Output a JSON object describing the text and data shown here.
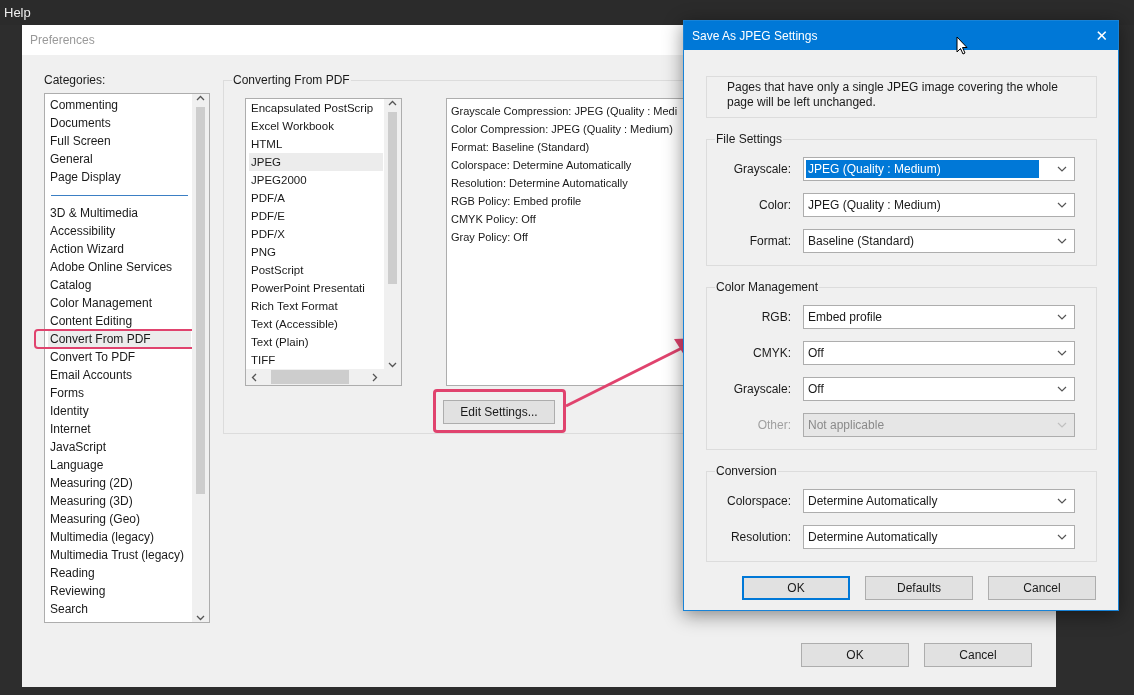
{
  "menu_bar": {
    "items": [
      "Help"
    ]
  },
  "preferences": {
    "title": "Preferences",
    "categories_label": "Categories:",
    "category_groups": [
      {
        "items": [
          {
            "label": "Commenting",
            "selected": false
          },
          {
            "label": "Documents",
            "selected": false
          },
          {
            "label": "Full Screen",
            "selected": false
          },
          {
            "label": "General",
            "selected": false
          },
          {
            "label": "Page Display",
            "selected": false
          }
        ]
      },
      {
        "items": [
          {
            "label": "3D & Multimedia",
            "selected": false
          },
          {
            "label": "Accessibility",
            "selected": false
          },
          {
            "label": "Action Wizard",
            "selected": false
          },
          {
            "label": "Adobe Online Services",
            "selected": false
          },
          {
            "label": "Catalog",
            "selected": false
          },
          {
            "label": "Color Management",
            "selected": false
          },
          {
            "label": "Content Editing",
            "selected": false
          },
          {
            "label": "Convert From PDF",
            "selected": true
          },
          {
            "label": "Convert To PDF",
            "selected": false
          },
          {
            "label": "Email Accounts",
            "selected": false
          },
          {
            "label": "Forms",
            "selected": false
          },
          {
            "label": "Identity",
            "selected": false
          },
          {
            "label": "Internet",
            "selected": false
          },
          {
            "label": "JavaScript",
            "selected": false
          },
          {
            "label": "Language",
            "selected": false
          },
          {
            "label": "Measuring (2D)",
            "selected": false
          },
          {
            "label": "Measuring (3D)",
            "selected": false
          },
          {
            "label": "Measuring (Geo)",
            "selected": false
          },
          {
            "label": "Multimedia (legacy)",
            "selected": false
          },
          {
            "label": "Multimedia Trust (legacy)",
            "selected": false
          },
          {
            "label": "Reading",
            "selected": false
          },
          {
            "label": "Reviewing",
            "selected": false
          },
          {
            "label": "Search",
            "selected": false
          }
        ]
      }
    ],
    "group_title": "Converting From PDF",
    "formats": [
      {
        "label": "Encapsulated PostScrip",
        "selected": false
      },
      {
        "label": "Excel Workbook",
        "selected": false
      },
      {
        "label": "HTML",
        "selected": false
      },
      {
        "label": "JPEG",
        "selected": true
      },
      {
        "label": "JPEG2000",
        "selected": false
      },
      {
        "label": "PDF/A",
        "selected": false
      },
      {
        "label": "PDF/E",
        "selected": false
      },
      {
        "label": "PDF/X",
        "selected": false
      },
      {
        "label": "PNG",
        "selected": false
      },
      {
        "label": "PostScript",
        "selected": false
      },
      {
        "label": "PowerPoint Presentati",
        "selected": false
      },
      {
        "label": "Rich Text Format",
        "selected": false
      },
      {
        "label": "Text (Accessible)",
        "selected": false
      },
      {
        "label": "Text (Plain)",
        "selected": false
      },
      {
        "label": "TIFF",
        "selected": false
      }
    ],
    "description": [
      "Grayscale Compression: JPEG (Quality : Medi",
      "Color Compression: JPEG (Quality : Medium)",
      "Format: Baseline (Standard)",
      "Colorspace: Determine Automatically",
      "Resolution: Determine Automatically",
      "RGB Policy: Embed profile",
      "CMYK Policy: Off",
      "Gray Policy: Off"
    ],
    "edit_button": "Edit Settings...",
    "buttons": [
      {
        "label": "OK"
      },
      {
        "label": "Cancel"
      }
    ]
  },
  "dialog": {
    "title": "Save As JPEG Settings",
    "close": "✕",
    "note": "Pages that have only a single JPEG image covering the whole page will be left unchanged.",
    "groups": [
      {
        "title": "File Settings",
        "fields": [
          {
            "label": "Grayscale:",
            "value": "JPEG (Quality : Medium)",
            "text_selected": true,
            "disabled": false
          },
          {
            "label": "Color:",
            "value": "JPEG (Quality : Medium)",
            "text_selected": false,
            "disabled": false
          },
          {
            "label": "Format:",
            "value": "Baseline (Standard)",
            "text_selected": false,
            "disabled": false
          }
        ]
      },
      {
        "title": "Color Management",
        "fields": [
          {
            "label": "RGB:",
            "value": "Embed profile",
            "text_selected": false,
            "disabled": false
          },
          {
            "label": "CMYK:",
            "value": "Off",
            "text_selected": false,
            "disabled": false
          },
          {
            "label": "Grayscale:",
            "value": "Off",
            "text_selected": false,
            "disabled": false
          },
          {
            "label": "Other:",
            "value": "Not applicable",
            "text_selected": false,
            "disabled": true
          }
        ]
      },
      {
        "title": "Conversion",
        "fields": [
          {
            "label": "Colorspace:",
            "value": "Determine Automatically",
            "text_selected": false,
            "disabled": false
          },
          {
            "label": "Resolution:",
            "value": "Determine Automatically",
            "text_selected": false,
            "disabled": false
          }
        ]
      }
    ],
    "buttons": [
      {
        "label": "OK",
        "focused": true
      },
      {
        "label": "Defaults",
        "focused": false
      },
      {
        "label": "Cancel",
        "focused": false
      }
    ]
  }
}
